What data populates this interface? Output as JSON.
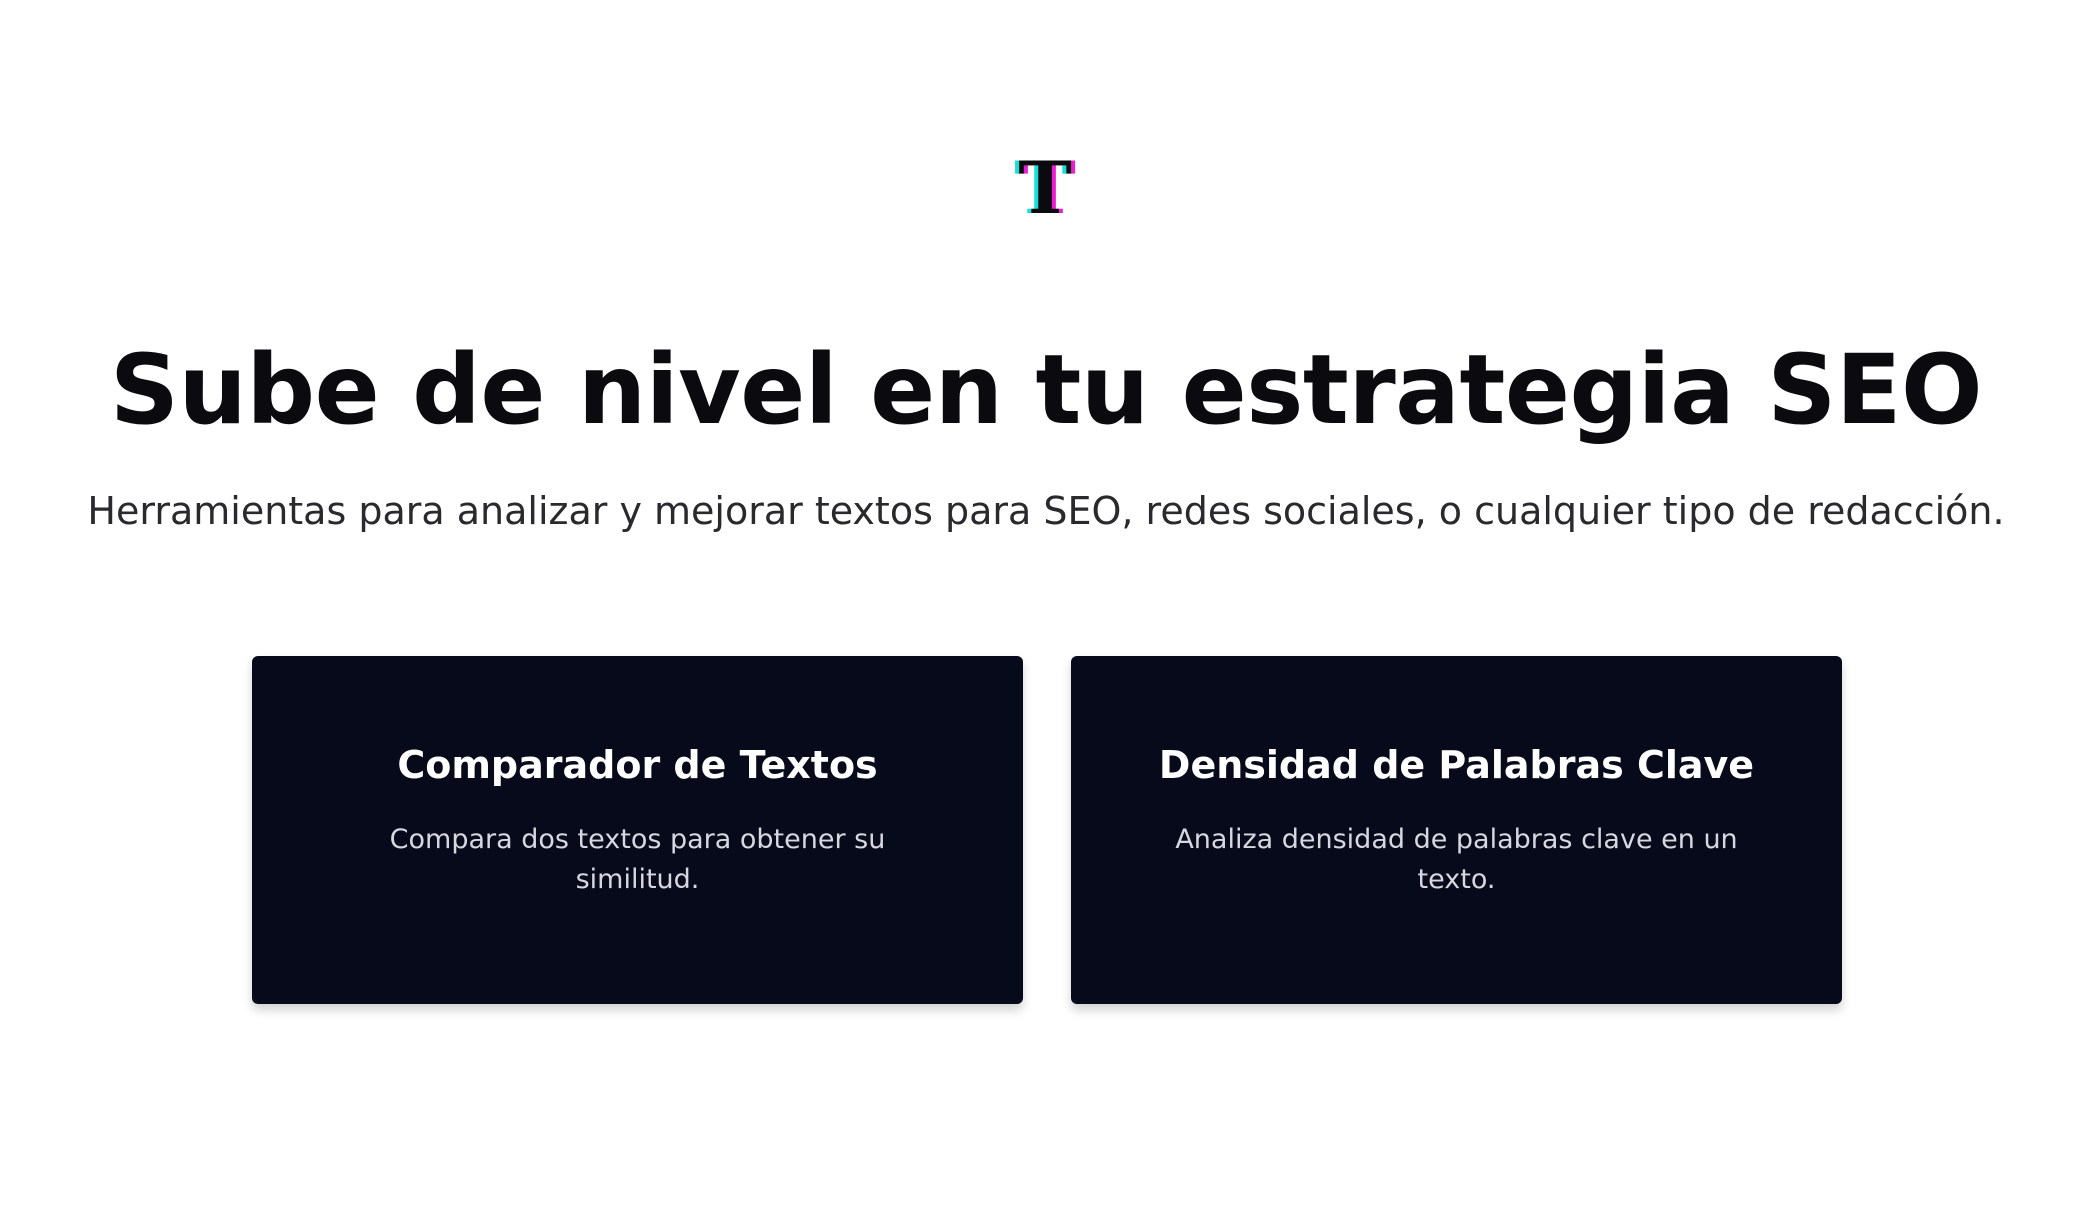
{
  "logo": {
    "letter": "T",
    "icon": "logo-t-icon",
    "colors": {
      "main": "#0b0b0f",
      "cyan": "#16e0d6",
      "magenta": "#e81fd0"
    }
  },
  "hero": {
    "title": "Sube de nivel en tu estrategia SEO",
    "subtitle": "Herramientas para analizar y mejorar textos para SEO, redes sociales, o cualquier tipo de redacción."
  },
  "cards": [
    {
      "title": "Comparador de Textos",
      "description": "Compara dos textos para obtener su similitud."
    },
    {
      "title": "Densidad de Palabras Clave",
      "description": "Analiza densidad de palabras clave en un texto."
    }
  ],
  "colors": {
    "card_background": "#060a1a",
    "text_primary": "#0b0b0f"
  }
}
